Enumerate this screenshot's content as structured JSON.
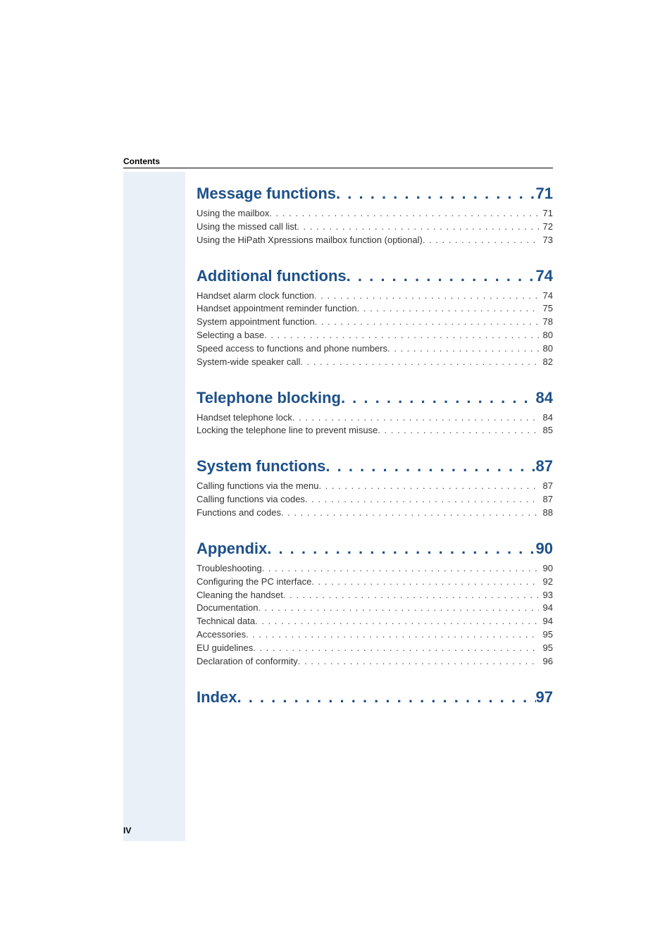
{
  "header": "Contents",
  "page_number": "IV",
  "colors": {
    "accent": "#1d5089",
    "sidebar": "#e9f0f7"
  },
  "sections": [
    {
      "title": "Message functions",
      "page": "71",
      "entries": [
        {
          "title": "Using the mailbox",
          "page": "71"
        },
        {
          "title": "Using the missed call list",
          "page": "72"
        },
        {
          "title": "Using the HiPath Xpressions mailbox function (optional)",
          "page": "73"
        }
      ]
    },
    {
      "title": "Additional functions",
      "page": "74",
      "entries": [
        {
          "title": "Handset alarm clock function",
          "page": "74"
        },
        {
          "title": "Handset appointment reminder function",
          "page": "75"
        },
        {
          "title": "System appointment function",
          "page": "78"
        },
        {
          "title": "Selecting a base",
          "page": "80"
        },
        {
          "title": "Speed access to functions and phone numbers",
          "page": "80"
        },
        {
          "title": "System-wide speaker call",
          "page": "82"
        }
      ]
    },
    {
      "title": "Telephone blocking",
      "page": "84",
      "entries": [
        {
          "title": "Handset telephone lock",
          "page": "84"
        },
        {
          "title": "Locking the telephone line to prevent misuse",
          "page": "85"
        }
      ]
    },
    {
      "title": "System functions",
      "page": "87",
      "entries": [
        {
          "title": "Calling functions via the menu",
          "page": "87"
        },
        {
          "title": "Calling functions via codes",
          "page": "87"
        },
        {
          "title": "Functions and codes",
          "page": "88"
        }
      ]
    },
    {
      "title": "Appendix",
      "page": "90",
      "entries": [
        {
          "title": "Troubleshooting",
          "page": "90"
        },
        {
          "title": "Configuring the PC interface",
          "page": "92"
        },
        {
          "title": "Cleaning the handset",
          "page": "93"
        },
        {
          "title": "Documentation",
          "page": "94"
        },
        {
          "title": "Technical data",
          "page": "94"
        },
        {
          "title": "Accessories",
          "page": "95"
        },
        {
          "title": "EU guidelines",
          "page": "95"
        },
        {
          "title": "Declaration of conformity",
          "page": "96"
        }
      ]
    },
    {
      "title": "Index",
      "page": "97",
      "entries": []
    }
  ]
}
